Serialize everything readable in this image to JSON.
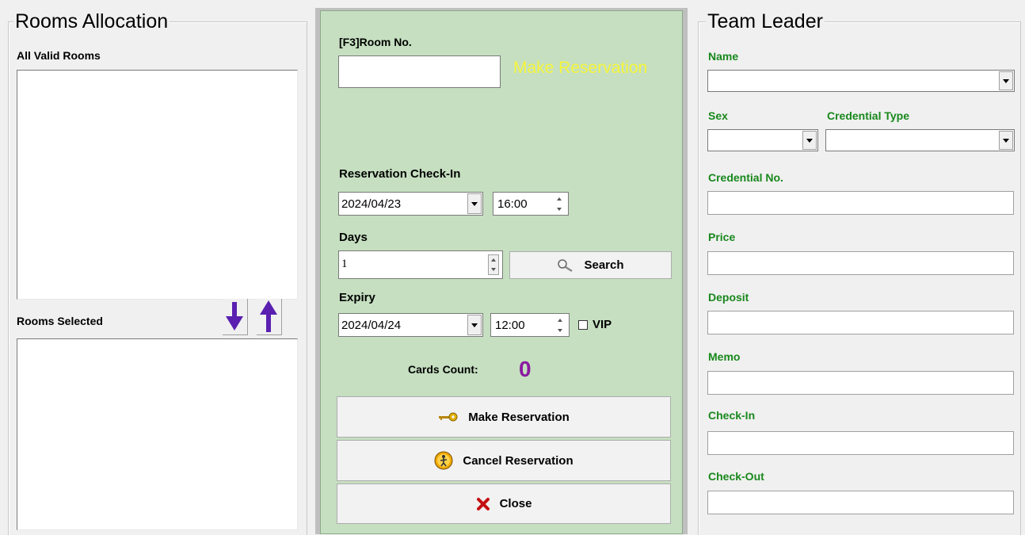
{
  "rooms_allocation": {
    "title": "Rooms Allocation",
    "all_valid_rooms_label": "All Valid Rooms",
    "rooms_selected_label": "Rooms Selected",
    "down_arrow_icon": "arrow-down-icon",
    "up_arrow_icon": "arrow-up-icon",
    "arrow_color": "#5a1fb0"
  },
  "reservation": {
    "room_no_label": "[F3]Room No.",
    "room_no_value": "",
    "make_reservation_hint": "Make Reservation",
    "hint_color": "#f5f53a",
    "checkin_label": "Reservation Check-In",
    "checkin_date": "2024/04/23",
    "checkin_time": "16:00",
    "days_label": "Days",
    "days_value": "1",
    "search_label": "Search",
    "expiry_label": "Expiry",
    "expiry_date": "2024/04/24",
    "expiry_time": "12:00",
    "vip_label": "VIP",
    "vip_checked": false,
    "cards_count_label": "Cards Count:",
    "cards_count_value": "0",
    "cards_count_color": "#8a1aa0",
    "panel_color": "#c5dfc0",
    "make_reservation_button": "Make Reservation",
    "cancel_reservation_button": "Cancel Reservation",
    "close_button": "Close"
  },
  "team_leader": {
    "title": "Team Leader",
    "name_label": "Name",
    "name_value": "",
    "sex_label": "Sex",
    "sex_value": "",
    "credential_type_label": "Credential Type",
    "credential_type_value": "",
    "credential_no_label": "Credential No.",
    "credential_no_value": "",
    "price_label": "Price",
    "price_value": "",
    "deposit_label": "Deposit",
    "deposit_value": "",
    "memo_label": "Memo",
    "memo_value": "",
    "checkin_label": "Check-In",
    "checkin_value": "",
    "checkout_label": "Check-Out",
    "checkout_value": "",
    "label_color": "#18881c"
  }
}
